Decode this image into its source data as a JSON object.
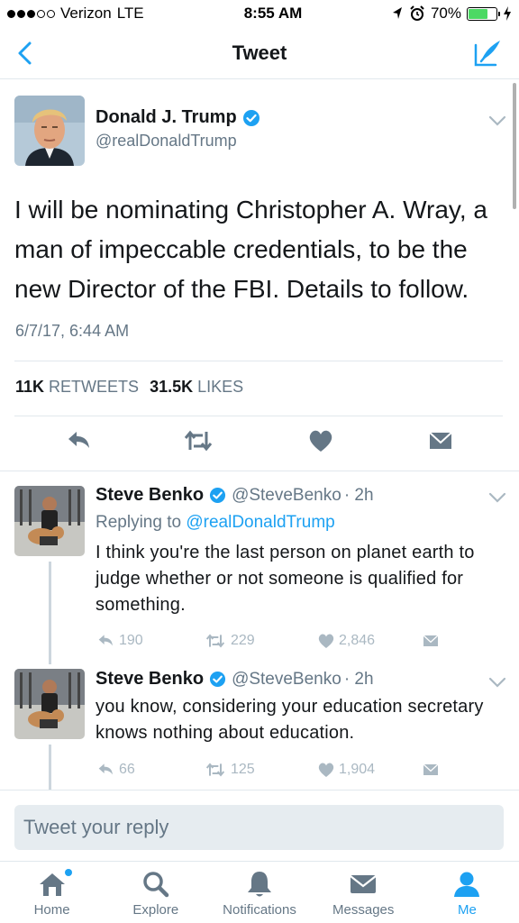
{
  "status_bar": {
    "carrier": "Verizon",
    "network": "LTE",
    "time": "8:55 AM",
    "battery": "70%",
    "battery_level": 0.7
  },
  "nav": {
    "title": "Tweet"
  },
  "tweet": {
    "author_name": "Donald J. Trump",
    "author_handle": "@realDonaldTrump",
    "text": "I will be nominating Christopher A. Wray, a man of impeccable credentials, to be the new Director of the FBI. Details to follow.",
    "timestamp": "6/7/17, 6:44 AM",
    "retweets_count": "11K",
    "retweets_label": "RETWEETS",
    "likes_count": "31.5K",
    "likes_label": "LIKES"
  },
  "replies": [
    {
      "name": "Steve Benko",
      "handle": "@SteveBenko",
      "time": "· 2h",
      "replying_prefix": "Replying to",
      "replying_to": "@realDonaldTrump",
      "text": "I think you're the last person on planet earth to judge whether or not someone is qualified for something.",
      "reply_count": "190",
      "retweet_count": "229",
      "like_count": "2,846"
    },
    {
      "name": "Steve Benko",
      "handle": "@SteveBenko",
      "time": "· 2h",
      "text": "you know, considering your education secretary knows nothing about education.",
      "reply_count": "66",
      "retweet_count": "125",
      "like_count": "1,904"
    }
  ],
  "reply_box": {
    "placeholder": "Tweet your reply"
  },
  "tabs": [
    {
      "label": "Home",
      "icon": "home-icon"
    },
    {
      "label": "Explore",
      "icon": "search-icon"
    },
    {
      "label": "Notifications",
      "icon": "bell-icon"
    },
    {
      "label": "Messages",
      "icon": "envelope-icon"
    },
    {
      "label": "Me",
      "icon": "person-icon"
    }
  ],
  "colors": {
    "accent": "#1da1f2",
    "verified": "#1da1f2",
    "muted": "#657786",
    "battery": "#4cd964"
  }
}
